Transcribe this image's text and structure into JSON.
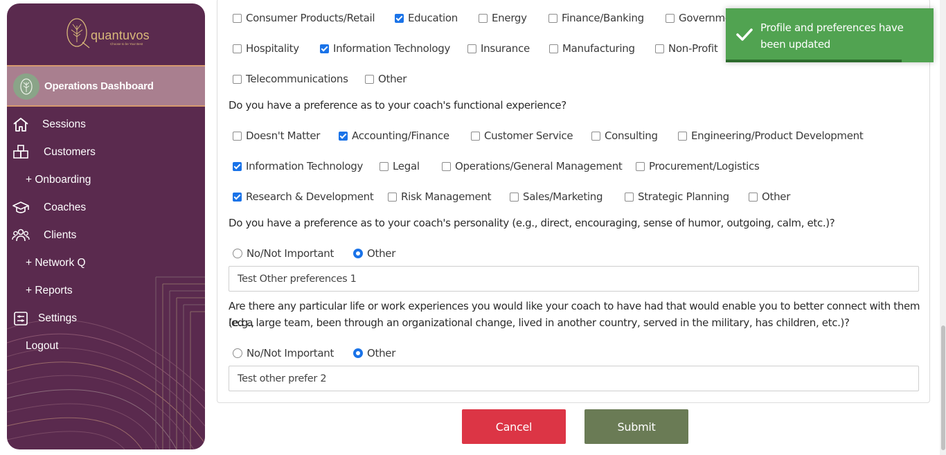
{
  "sidebar": {
    "brand": {
      "name": "quantuvos",
      "tagline": "Choose to be Your Best"
    },
    "active_item": "Operations Dashboard",
    "items": [
      {
        "label": "Sessions",
        "icon": "home-icon"
      },
      {
        "label": "Customers",
        "icon": "boxes-icon"
      },
      {
        "label": "+ Onboarding",
        "icon": ""
      },
      {
        "label": "Coaches",
        "icon": "graduation-cap-icon"
      },
      {
        "label": "Clients",
        "icon": "users-icon"
      },
      {
        "label": "+ Network Q",
        "icon": ""
      },
      {
        "label": "+ Reports",
        "icon": ""
      },
      {
        "label": "Settings",
        "icon": "settings-list-icon"
      },
      {
        "label": "Logout",
        "icon": ""
      }
    ]
  },
  "industry": {
    "options": [
      {
        "label": "Consumer Products/Retail",
        "checked": false
      },
      {
        "label": "Education",
        "checked": true
      },
      {
        "label": "Energy",
        "checked": false
      },
      {
        "label": "Finance/Banking",
        "checked": false
      },
      {
        "label": "Governme",
        "checked": false
      },
      {
        "label": "Hospitality",
        "checked": false
      },
      {
        "label": "Information Technology",
        "checked": true
      },
      {
        "label": "Insurance",
        "checked": false
      },
      {
        "label": "Manufacturing",
        "checked": false
      },
      {
        "label": "Non-Profit",
        "checked": false
      },
      {
        "label": "Telecommunications",
        "checked": false
      },
      {
        "label": "Other",
        "checked": false
      }
    ]
  },
  "functional": {
    "question": "Do you have a preference as to your coach's functional experience?",
    "options": [
      {
        "label": "Doesn't Matter",
        "checked": false
      },
      {
        "label": "Accounting/Finance",
        "checked": true
      },
      {
        "label": "Customer Service",
        "checked": false
      },
      {
        "label": "Consulting",
        "checked": false
      },
      {
        "label": "Engineering/Product Development",
        "checked": false
      },
      {
        "label": "Information Technology",
        "checked": true
      },
      {
        "label": "Legal",
        "checked": false
      },
      {
        "label": "Operations/General Management",
        "checked": false
      },
      {
        "label": "Procurement/Logistics",
        "checked": false
      },
      {
        "label": "Research & Development",
        "checked": true
      },
      {
        "label": "Risk Management",
        "checked": false
      },
      {
        "label": "Sales/Marketing",
        "checked": false
      },
      {
        "label": "Strategic Planning",
        "checked": false
      },
      {
        "label": "Other",
        "checked": false
      }
    ]
  },
  "personality": {
    "question": "Do you have a preference as to your coach's personality (e.g., direct, encouraging, sense of humor, outgoing, calm, etc.)?",
    "options": [
      {
        "label": "No/Not Important",
        "selected": false
      },
      {
        "label": "Other",
        "selected": true
      }
    ],
    "other_value": "Test Other preferences 1"
  },
  "experience": {
    "question_line1": "Are there any particular life or work experiences you would like your coach to have had that would enable you to better connect with them (e.g.,",
    "question_line2": "led a large team, been through an organizational change, lived in another country, served in the military, has children, etc.)?",
    "options": [
      {
        "label": "No/Not Important",
        "selected": false
      },
      {
        "label": "Other",
        "selected": true
      }
    ],
    "other_value": "Test other prefer 2"
  },
  "actions": {
    "cancel": "Cancel",
    "submit": "Submit"
  },
  "toast": {
    "message": "Profile and preferences have been updated",
    "color": "#51a351"
  },
  "colors": {
    "sidebar": "#5a2a4e",
    "accent": "#1a73e8",
    "cancel": "#dc3545",
    "submit": "#6a7b55"
  }
}
